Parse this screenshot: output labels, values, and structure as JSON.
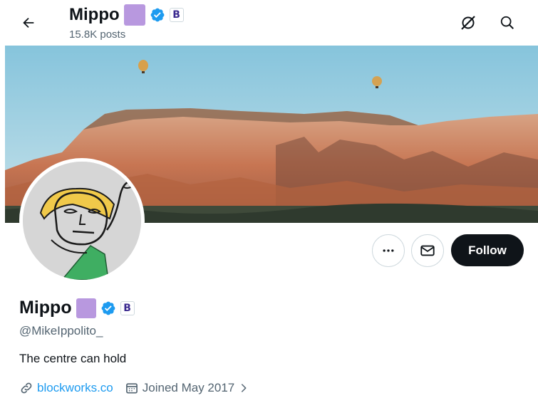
{
  "header": {
    "back_icon": "arrow-left-icon",
    "name": "Mippo",
    "posts": "15.8K posts",
    "icons": [
      "grok-icon",
      "search-icon"
    ]
  },
  "colors": {
    "verified": "#1d9bf0",
    "emoji_square": "#b898df",
    "follow_bg": "#0f1419",
    "link": "#1d9bf0",
    "secondary_text": "#536471"
  },
  "actions": {
    "more_icon": "more-dots-icon",
    "message_icon": "envelope-icon",
    "follow_label": "Follow"
  },
  "profile": {
    "name": "Mippo",
    "handle": "@MikeIppolito_",
    "bio": "The centre can hold",
    "badge_letter": "B",
    "website": "blockworks.co",
    "joined": "Joined May 2017",
    "link_icon": "link-icon",
    "calendar_icon": "calendar-icon",
    "chevron_icon": "chevron-right-icon"
  }
}
